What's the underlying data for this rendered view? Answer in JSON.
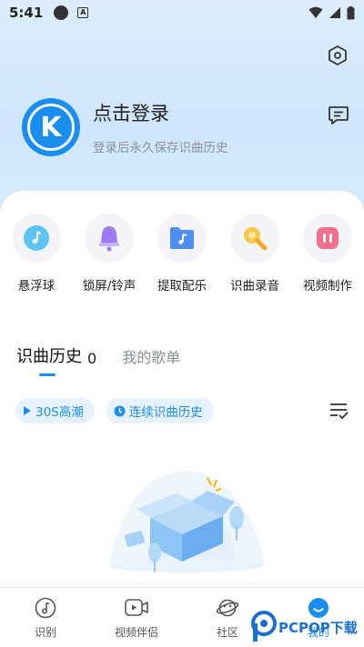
{
  "status_bar": {
    "time": "5:41",
    "a_label": "A"
  },
  "profile": {
    "avatar_letter": "K",
    "login_title": "点击登录",
    "login_subtitle": "登录后永久保存识曲历史"
  },
  "tools": [
    {
      "label": "悬浮球",
      "icon": "music-ball-icon"
    },
    {
      "label": "锁屏/铃声",
      "icon": "bell-icon"
    },
    {
      "label": "提取配乐",
      "icon": "music-folder-icon"
    },
    {
      "label": "识曲录音",
      "icon": "record-bulb-icon"
    },
    {
      "label": "视频制作",
      "icon": "video-make-icon"
    }
  ],
  "tabs": {
    "history_label": "识曲历史",
    "history_count": "0",
    "playlist_label": "我的歌单"
  },
  "chips": {
    "chorus_label": "30S高潮",
    "continuous_label": "连续识曲历史"
  },
  "bottom_nav": [
    {
      "label": "识别",
      "icon": "music-note-icon"
    },
    {
      "label": "视频伴侣",
      "icon": "video-icon"
    },
    {
      "label": "社区",
      "icon": "planet-icon"
    },
    {
      "label": "我的",
      "icon": "face-icon"
    }
  ],
  "watermark": {
    "text": "PCPOP下载"
  },
  "colors": {
    "accent": "#1a8ef0",
    "header_bg": "#d6eafb",
    "chip_bg": "#e6f2fd"
  }
}
